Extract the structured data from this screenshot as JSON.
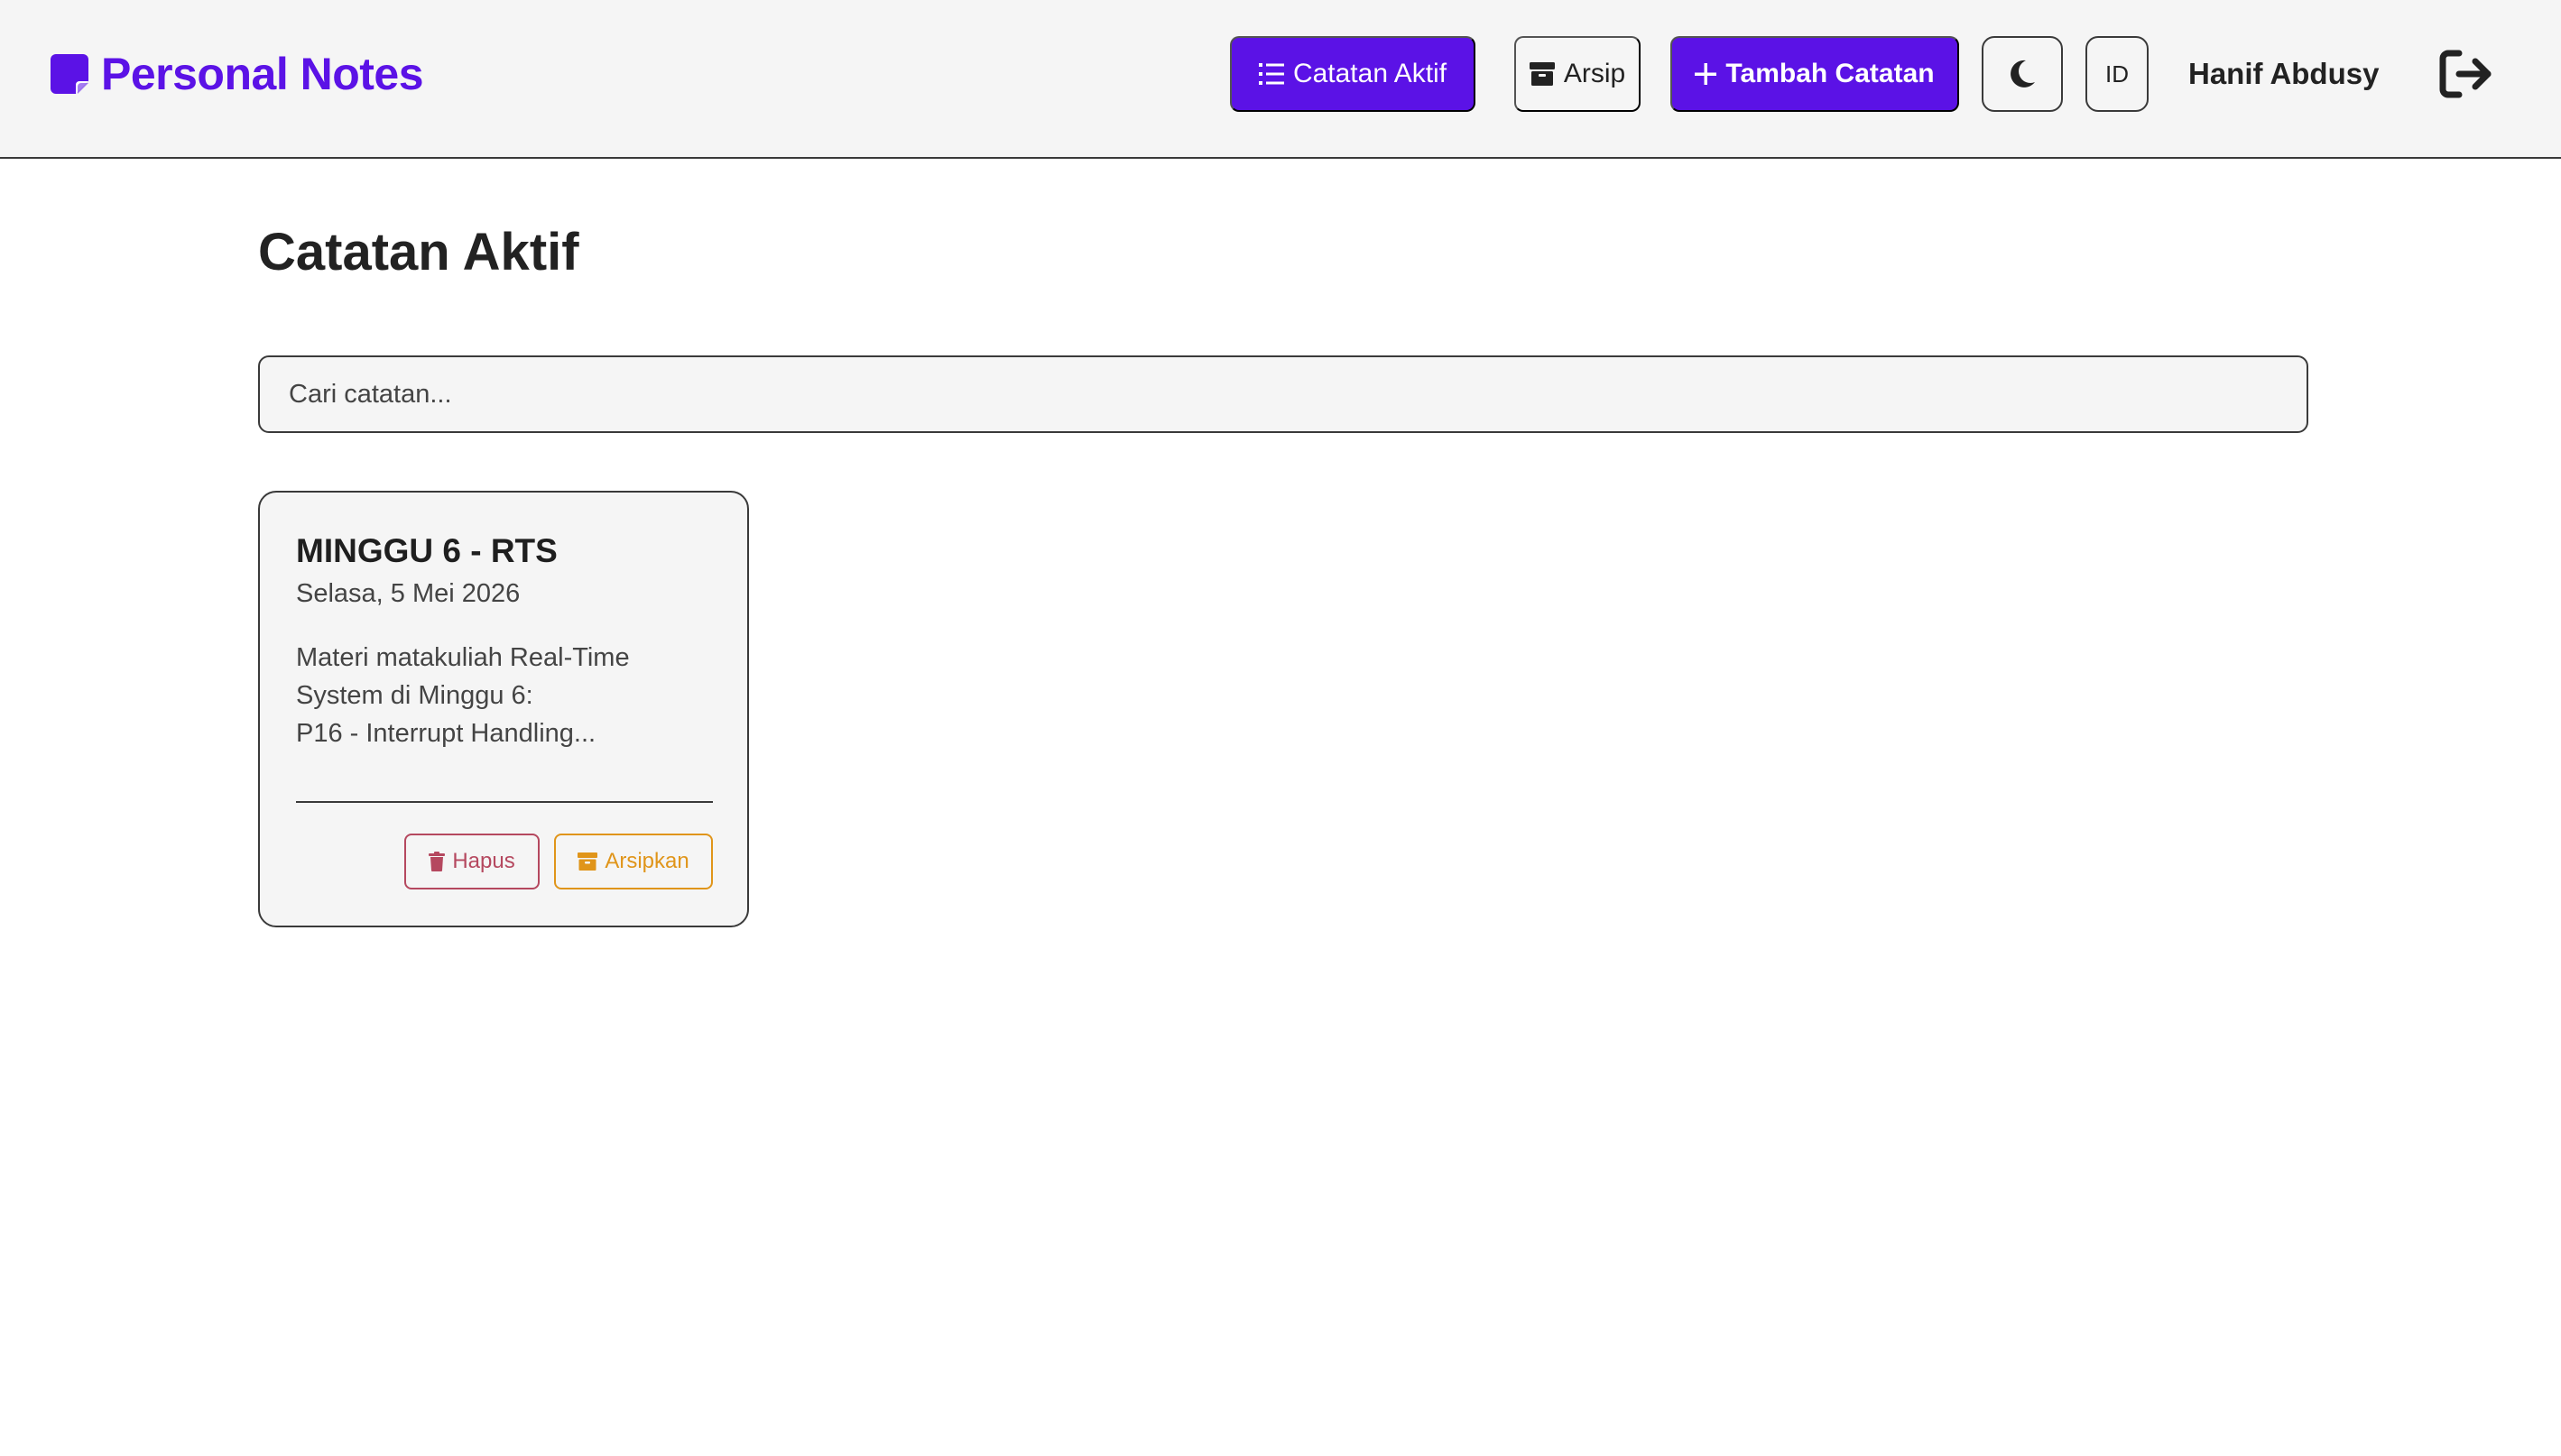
{
  "header": {
    "brand": "Personal Notes",
    "nav": {
      "active_label": "Catatan Aktif",
      "archive_label": "Arsip",
      "add_label": "Tambah Catatan",
      "lang_label": "ID"
    },
    "user_name": "Hanif Abdusy"
  },
  "main": {
    "title": "Catatan Aktif",
    "search": {
      "placeholder": "Cari catatan...",
      "value": ""
    },
    "notes": [
      {
        "title": "MINGGU 6 - RTS",
        "date": "Selasa, 5 Mei 2026",
        "body": "Materi matakuliah Real-Time\nSystem di Minggu 6:\nP16 - Interrupt Handling...",
        "delete_label": "Hapus",
        "archive_label": "Arsipkan"
      }
    ]
  },
  "icons": {
    "brand": "note-icon",
    "active": "list-icon",
    "archive": "archive-box-icon",
    "add": "plus-icon",
    "theme": "moon-icon",
    "logout": "logout-icon",
    "delete": "trash-icon"
  },
  "colors": {
    "accent": "#5b12e6",
    "delete": "#b5485f",
    "archive": "#e0951a",
    "surface": "#f5f5f5"
  }
}
